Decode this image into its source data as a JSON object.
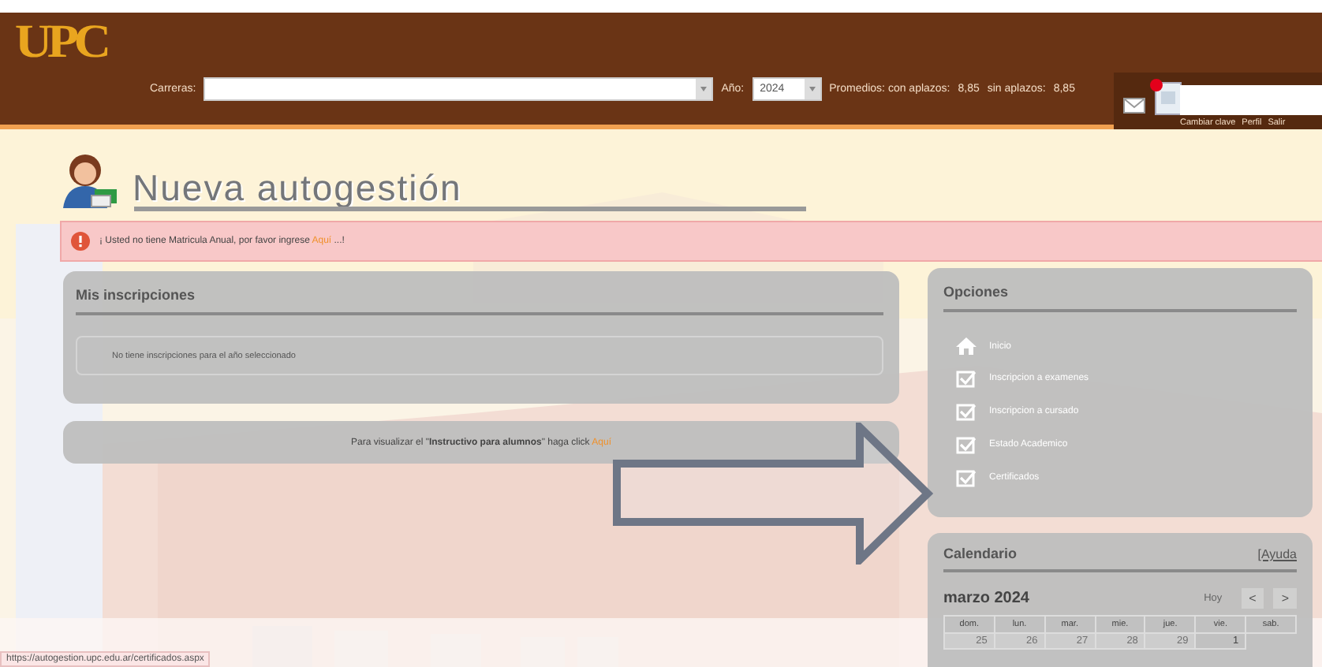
{
  "header": {
    "logo": "UPC",
    "careers_label": "Carreras:",
    "year_label": "Año:",
    "year": "2024",
    "averages_label": "Promedios: con aplazos:",
    "average_with": "8,85",
    "without_label": "sin aplazos:",
    "average_without": "8,85",
    "notification": true,
    "user_links": [
      "Cambiar clave",
      "Perfil",
      "Salir"
    ]
  },
  "page_title": "Nueva autogestión",
  "alert": {
    "text": "¡ Usted no tiene Matricula Anual, por favor ingrese",
    "link": "Aquí",
    "after": "...!"
  },
  "inscriptions": {
    "title": "Mis inscripciones",
    "empty_text": "No tiene inscripciones para el año seleccionado"
  },
  "instructions": {
    "text": "Para visualizar el \"**Instructivo para alumnos**\" haga click",
    "link": "Aquí"
  },
  "options": {
    "title": "Opciones",
    "items": [
      {
        "kind": "home",
        "label": "Inicio"
      },
      {
        "kind": "check",
        "label": "Inscripcion a examenes"
      },
      {
        "kind": "check",
        "label": "Inscripcion a cursado"
      },
      {
        "kind": "check",
        "label": "Estado Academico"
      },
      {
        "kind": "check",
        "label": "Certificados"
      }
    ]
  },
  "calendar": {
    "title": "Calendario",
    "help": "[Ayuda",
    "month": "marzo 2024",
    "today": "Hoy",
    "prev": "<",
    "next": ">",
    "weekdays": [
      "dom.",
      "lun.",
      "mar.",
      "mie.",
      "jue.",
      "vie.",
      "sab."
    ],
    "days": [
      {
        "label": "25",
        "muted": true
      },
      {
        "label": "26",
        "muted": true
      },
      {
        "label": "27",
        "muted": true
      },
      {
        "label": "28",
        "muted": true
      },
      {
        "label": "29",
        "muted": true
      },
      {
        "label": "1",
        "muted": false
      }
    ]
  },
  "status_url": "https://autogestion.upc.edu.ar/certificados.aspx"
}
